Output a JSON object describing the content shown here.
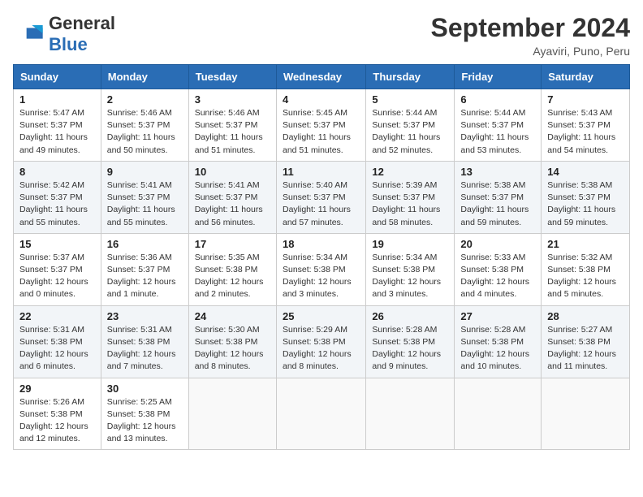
{
  "header": {
    "logo_line1": "General",
    "logo_line2": "Blue",
    "month": "September 2024",
    "location": "Ayaviri, Puno, Peru"
  },
  "weekdays": [
    "Sunday",
    "Monday",
    "Tuesday",
    "Wednesday",
    "Thursday",
    "Friday",
    "Saturday"
  ],
  "weeks": [
    [
      {
        "day": "1",
        "info": "Sunrise: 5:47 AM\nSunset: 5:37 PM\nDaylight: 11 hours and 49 minutes."
      },
      {
        "day": "2",
        "info": "Sunrise: 5:46 AM\nSunset: 5:37 PM\nDaylight: 11 hours and 50 minutes."
      },
      {
        "day": "3",
        "info": "Sunrise: 5:46 AM\nSunset: 5:37 PM\nDaylight: 11 hours and 51 minutes."
      },
      {
        "day": "4",
        "info": "Sunrise: 5:45 AM\nSunset: 5:37 PM\nDaylight: 11 hours and 51 minutes."
      },
      {
        "day": "5",
        "info": "Sunrise: 5:44 AM\nSunset: 5:37 PM\nDaylight: 11 hours and 52 minutes."
      },
      {
        "day": "6",
        "info": "Sunrise: 5:44 AM\nSunset: 5:37 PM\nDaylight: 11 hours and 53 minutes."
      },
      {
        "day": "7",
        "info": "Sunrise: 5:43 AM\nSunset: 5:37 PM\nDaylight: 11 hours and 54 minutes."
      }
    ],
    [
      {
        "day": "8",
        "info": "Sunrise: 5:42 AM\nSunset: 5:37 PM\nDaylight: 11 hours and 55 minutes."
      },
      {
        "day": "9",
        "info": "Sunrise: 5:41 AM\nSunset: 5:37 PM\nDaylight: 11 hours and 55 minutes."
      },
      {
        "day": "10",
        "info": "Sunrise: 5:41 AM\nSunset: 5:37 PM\nDaylight: 11 hours and 56 minutes."
      },
      {
        "day": "11",
        "info": "Sunrise: 5:40 AM\nSunset: 5:37 PM\nDaylight: 11 hours and 57 minutes."
      },
      {
        "day": "12",
        "info": "Sunrise: 5:39 AM\nSunset: 5:37 PM\nDaylight: 11 hours and 58 minutes."
      },
      {
        "day": "13",
        "info": "Sunrise: 5:38 AM\nSunset: 5:37 PM\nDaylight: 11 hours and 59 minutes."
      },
      {
        "day": "14",
        "info": "Sunrise: 5:38 AM\nSunset: 5:37 PM\nDaylight: 11 hours and 59 minutes."
      }
    ],
    [
      {
        "day": "15",
        "info": "Sunrise: 5:37 AM\nSunset: 5:37 PM\nDaylight: 12 hours and 0 minutes."
      },
      {
        "day": "16",
        "info": "Sunrise: 5:36 AM\nSunset: 5:37 PM\nDaylight: 12 hours and 1 minute."
      },
      {
        "day": "17",
        "info": "Sunrise: 5:35 AM\nSunset: 5:38 PM\nDaylight: 12 hours and 2 minutes."
      },
      {
        "day": "18",
        "info": "Sunrise: 5:34 AM\nSunset: 5:38 PM\nDaylight: 12 hours and 3 minutes."
      },
      {
        "day": "19",
        "info": "Sunrise: 5:34 AM\nSunset: 5:38 PM\nDaylight: 12 hours and 3 minutes."
      },
      {
        "day": "20",
        "info": "Sunrise: 5:33 AM\nSunset: 5:38 PM\nDaylight: 12 hours and 4 minutes."
      },
      {
        "day": "21",
        "info": "Sunrise: 5:32 AM\nSunset: 5:38 PM\nDaylight: 12 hours and 5 minutes."
      }
    ],
    [
      {
        "day": "22",
        "info": "Sunrise: 5:31 AM\nSunset: 5:38 PM\nDaylight: 12 hours and 6 minutes."
      },
      {
        "day": "23",
        "info": "Sunrise: 5:31 AM\nSunset: 5:38 PM\nDaylight: 12 hours and 7 minutes."
      },
      {
        "day": "24",
        "info": "Sunrise: 5:30 AM\nSunset: 5:38 PM\nDaylight: 12 hours and 8 minutes."
      },
      {
        "day": "25",
        "info": "Sunrise: 5:29 AM\nSunset: 5:38 PM\nDaylight: 12 hours and 8 minutes."
      },
      {
        "day": "26",
        "info": "Sunrise: 5:28 AM\nSunset: 5:38 PM\nDaylight: 12 hours and 9 minutes."
      },
      {
        "day": "27",
        "info": "Sunrise: 5:28 AM\nSunset: 5:38 PM\nDaylight: 12 hours and 10 minutes."
      },
      {
        "day": "28",
        "info": "Sunrise: 5:27 AM\nSunset: 5:38 PM\nDaylight: 12 hours and 11 minutes."
      }
    ],
    [
      {
        "day": "29",
        "info": "Sunrise: 5:26 AM\nSunset: 5:38 PM\nDaylight: 12 hours and 12 minutes."
      },
      {
        "day": "30",
        "info": "Sunrise: 5:25 AM\nSunset: 5:38 PM\nDaylight: 12 hours and 13 minutes."
      },
      {
        "day": "",
        "info": ""
      },
      {
        "day": "",
        "info": ""
      },
      {
        "day": "",
        "info": ""
      },
      {
        "day": "",
        "info": ""
      },
      {
        "day": "",
        "info": ""
      }
    ]
  ]
}
